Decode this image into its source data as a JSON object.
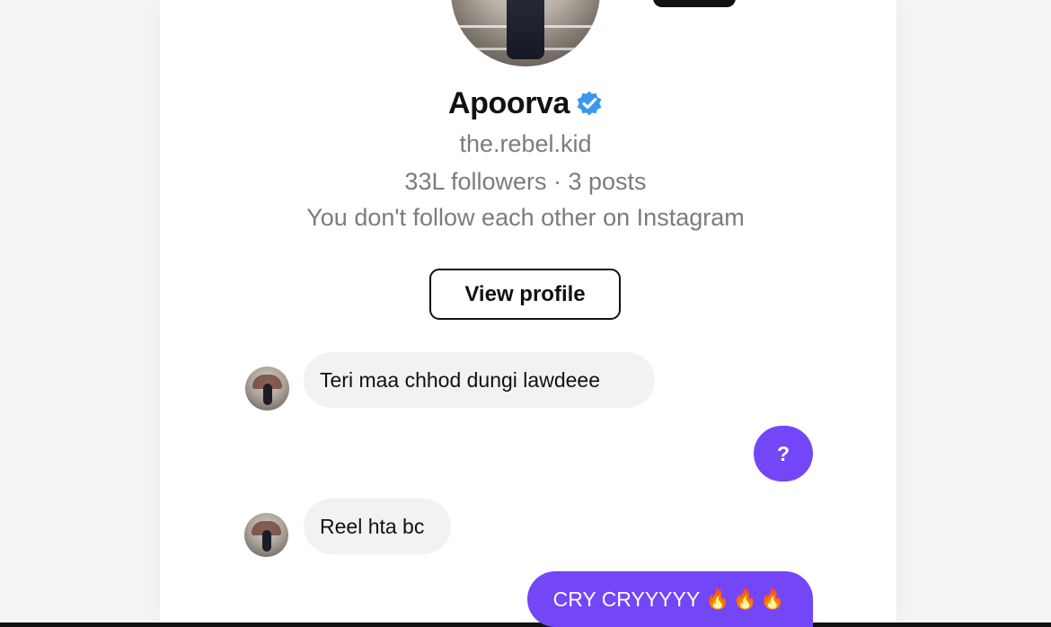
{
  "profile": {
    "name": "Apoorva",
    "username": "the.rebel.kid",
    "stats": "33L followers · 3 posts",
    "relationship": "You don't follow each other on Instagram",
    "view_profile_label": "View profile",
    "verified_icon": "verified-badge-icon",
    "colors": {
      "verified_blue": "#3897f0",
      "text_primary": "#111111",
      "text_secondary": "#7b7b82"
    }
  },
  "messages": [
    {
      "direction": "incoming",
      "text": "Teri maa chhod dungi lawdeee"
    },
    {
      "direction": "outgoing",
      "text": "?"
    },
    {
      "direction": "incoming",
      "text": "Reel hta bc"
    },
    {
      "direction": "outgoing",
      "text": "CRY CRYYYYY",
      "icons": "🔥🔥🔥"
    }
  ],
  "theme": {
    "outgoing_bubble": "#7346f7",
    "incoming_bubble": "#f2f2f4",
    "background": "#ffffff"
  }
}
